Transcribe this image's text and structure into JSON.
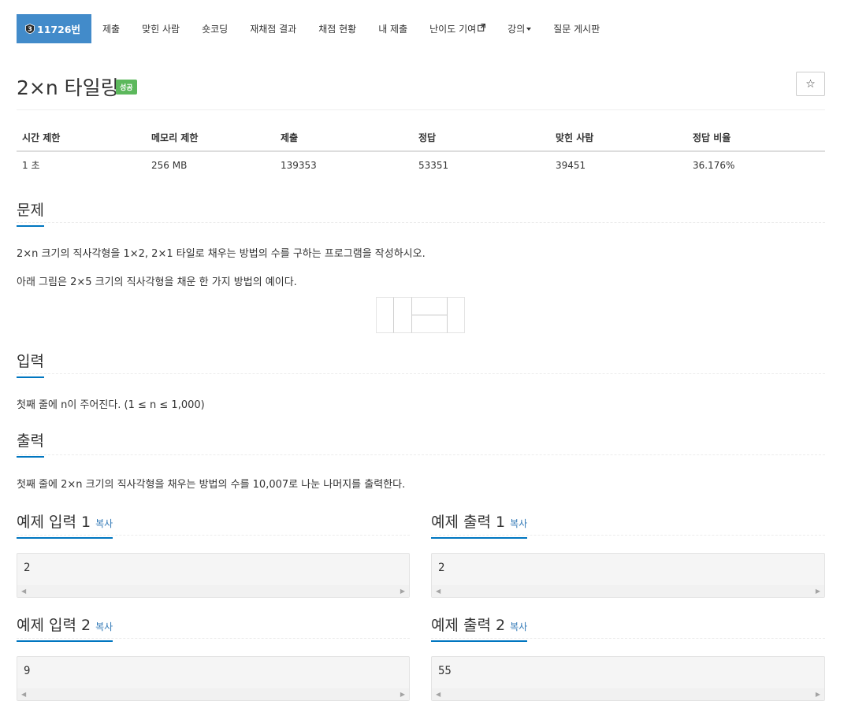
{
  "nav": {
    "problem_tab": "11726번",
    "tier_digit": "3",
    "items": [
      "제출",
      "맞힌 사람",
      "숏코딩",
      "재채점 결과",
      "채점 현황",
      "내 제출",
      "난이도 기여",
      "강의",
      "질문 게시판"
    ]
  },
  "title": {
    "text": "2×n 타일링",
    "badge": "성공",
    "star": "☆"
  },
  "stats": {
    "headers": [
      "시간 제한",
      "메모리 제한",
      "제출",
      "정답",
      "맞힌 사람",
      "정답 비율"
    ],
    "values": [
      "1 초",
      "256 MB",
      "139353",
      "53351",
      "39451",
      "36.176%"
    ]
  },
  "problem": {
    "heading": "문제",
    "line1": "2×n 크기의 직사각형을 1×2, 2×1 타일로 채우는 방법의 수를 구하는 프로그램을 작성하시오.",
    "line2": "아래 그림은 2×5 크기의 직사각형을 채운 한 가지 방법의 예이다."
  },
  "input": {
    "heading": "입력",
    "text": "첫째 줄에 n이 주어진다. (1 ≤ n ≤ 1,000)"
  },
  "output": {
    "heading": "출력",
    "text": "첫째 줄에 2×n 크기의 직사각형을 채우는 방법의 수를 10,007로 나눈 나머지를 출력한다."
  },
  "samples": {
    "copy_label": "복사",
    "in1": {
      "heading": "예제 입력 1",
      "value": "2"
    },
    "out1": {
      "heading": "예제 출력 1",
      "value": "2"
    },
    "in2": {
      "heading": "예제 입력 2",
      "value": "9"
    },
    "out2": {
      "heading": "예제 출력 2",
      "value": "55"
    }
  },
  "colors": {
    "accent": "#428bca",
    "success": "#5cb85c",
    "heading_underline": "#0076c0"
  },
  "icons": {
    "external": "external-link-icon",
    "caret": "caret-down-icon",
    "star": "star-icon",
    "tier": "tier-badge-icon"
  }
}
